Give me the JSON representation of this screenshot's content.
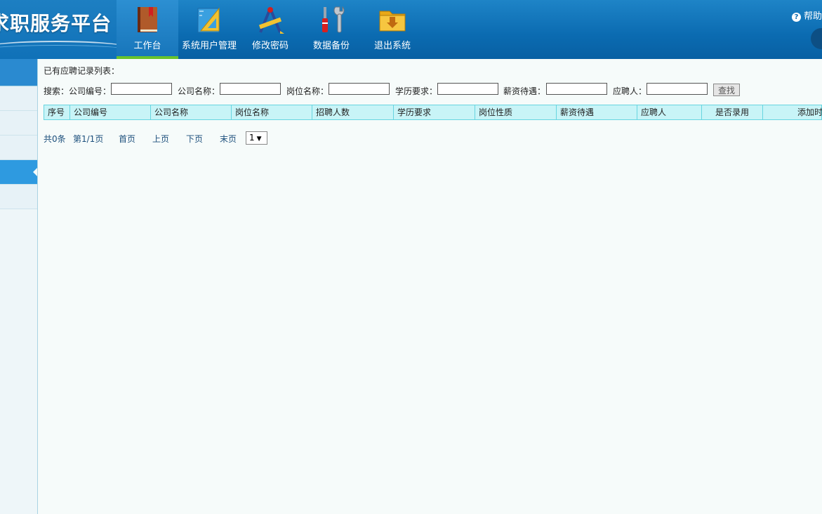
{
  "header": {
    "title": "求职服务平台",
    "help": "帮助",
    "nav": [
      {
        "label": "工作台",
        "icon": "book-icon",
        "active": true
      },
      {
        "label": "系统用户管理",
        "icon": "ruler-triangle-icon",
        "active": false
      },
      {
        "label": "修改密码",
        "icon": "pencil-compass-icon",
        "active": false
      },
      {
        "label": "数据备份",
        "icon": "tools-icon",
        "active": false
      },
      {
        "label": "退出系统",
        "icon": "folder-download-icon",
        "active": false
      }
    ]
  },
  "main": {
    "list_title": "已有应聘记录列表：",
    "search": {
      "prefix": "搜索：",
      "fields": [
        {
          "label": "公司编号：",
          "value": ""
        },
        {
          "label": "公司名称：",
          "value": ""
        },
        {
          "label": "岗位名称：",
          "value": ""
        },
        {
          "label": "学历要求：",
          "value": ""
        },
        {
          "label": "薪资待遇：",
          "value": ""
        },
        {
          "label": "应聘人：",
          "value": ""
        }
      ],
      "button": "查找"
    },
    "table": {
      "columns": [
        "序号",
        "公司编号",
        "公司名称",
        "岗位名称",
        "招聘人数",
        "学历要求",
        "岗位性质",
        "薪资待遇",
        "应聘人",
        "是否录用",
        "添加时"
      ],
      "rows": []
    },
    "pager": {
      "total": "共0条",
      "page_info": "第1/1页",
      "first": "首页",
      "prev": "上页",
      "next": "下页",
      "last": "末页",
      "selected_page": "1"
    }
  },
  "colors": {
    "header_bg": "#0b6bb1",
    "active_underline": "#68c32c",
    "table_header_bg": "#c8f4f7",
    "sidebar_active": "#2e9ae0"
  }
}
